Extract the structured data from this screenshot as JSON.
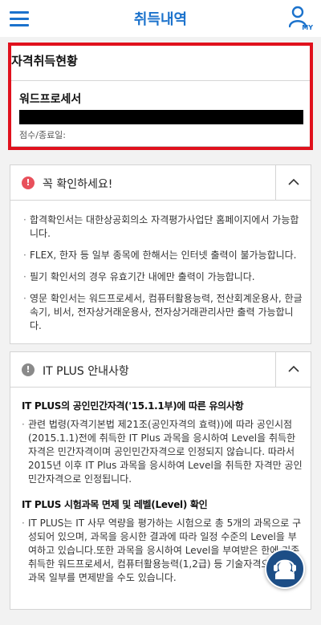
{
  "header": {
    "title": "취득내역",
    "my_label": "MY",
    "menu_icon": "hamburger-icon",
    "my_icon": "user-icon"
  },
  "status": {
    "title": "자격취득현황",
    "cert_name": "워드프로세서",
    "score_label": "점수/종료일:"
  },
  "notice": {
    "title": "꼭 확인하세요!",
    "icon": "alert-icon",
    "items": [
      "합격확인서는 대한상공회의소 자격평가사업단 홈페이지에서 가능합니다.",
      "FLEX, 한자 등 일부 종목에 한해서는 인터넷 출력이 불가능합니다.",
      "필기 확인서의 경우 유효기간 내에만 출력이 가능합니다.",
      "영문 확인서는 워드프로세서, 컴퓨터활용능력, 전산회계운용사, 한글속기, 비서, 전자상거래운용사, 전자상거래관리사만 출력 가능합니다."
    ]
  },
  "itplus": {
    "title": "IT PLUS 안내사항",
    "icon": "info-icon",
    "section1_title": "IT PLUS의 공인민간자격('15.1.1부)에 따른 유의사항",
    "section1_text": "관련 법령(자격기본법 제21조(공인자격의 효력))에 따라 공인시점(2015.1.1)전에 취득한 IT Plus 과목을 응시하여 Level을 취득한 자격은 민간자격이며 공인민간자격으로 인정되지 않습니다. 따라서 2015년 이후 IT Plus 과목을 응시하여 Level을 취득한 자격만 공인민간자격으로 인정됩니다.",
    "section2_title": "IT PLUS 시험과목 면제 및 레벨(Level) 확인",
    "section2_text": "IT PLUS는 IT 사무 역량을 평가하는 시험으로 총 5개의 과목으로 구성되어 있으며, 과목을 응시한 결과에 따라 일정 수준의 Level을 부여하고 있습니다.또한 과목을 응시하여 Level을 부여받은 한에 기존 취득한 워드프로세서, 컴퓨터활용능력(1,2급) 등 기술자격으로 시험과목 일부를 면제받을 수도 있습니다."
  },
  "chat": {
    "icon": "headset-icon"
  },
  "colors": {
    "accent": "#1b72cc",
    "highlight": "#e0111d",
    "alert": "#e8505b",
    "info": "#8a8a8a",
    "chat": "#1d4e86"
  }
}
